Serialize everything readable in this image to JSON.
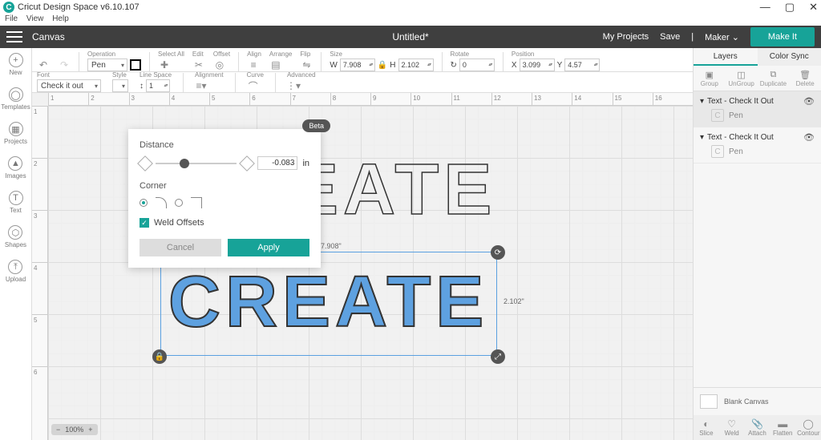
{
  "app": {
    "title": "Cricut Design Space v6.10.107"
  },
  "menu": {
    "file": "File",
    "view": "View",
    "help": "Help"
  },
  "top": {
    "canvas": "Canvas",
    "doc": "Untitled*",
    "projects": "My Projects",
    "save": "Save",
    "machine": "Maker",
    "makeit": "Make It"
  },
  "leftnav": [
    {
      "label": "New",
      "glyph": "+"
    },
    {
      "label": "Templates",
      "glyph": "◯"
    },
    {
      "label": "Projects",
      "glyph": "▦"
    },
    {
      "label": "Images",
      "glyph": "▲"
    },
    {
      "label": "Text",
      "glyph": "T"
    },
    {
      "label": "Shapes",
      "glyph": "⬡"
    },
    {
      "label": "Upload",
      "glyph": "⤒"
    }
  ],
  "ribbon": {
    "operation": {
      "label": "Operation",
      "value": "Pen"
    },
    "selectall": "Select All",
    "edit": "Edit",
    "offset": "Offset",
    "align": "Align",
    "arrange": "Arrange",
    "flip": "Flip",
    "size": {
      "label": "Size",
      "w": "7.908",
      "h": "2.102"
    },
    "rotate": {
      "label": "Rotate",
      "value": "0"
    },
    "position": {
      "label": "Position",
      "x": "3.099",
      "y": "4.57"
    }
  },
  "ribbon2": {
    "font": {
      "label": "Font",
      "value": "Check it out"
    },
    "style": "Style",
    "lineSpace": {
      "label": "Line Space",
      "value": "1"
    },
    "alignment": "Alignment",
    "curve": "Curve",
    "advanced": "Advanced"
  },
  "popup": {
    "beta": "Beta",
    "distance": "Distance",
    "distval": "-0.083",
    "distunit": "in",
    "corner": "Corner",
    "weld": "Weld Offsets",
    "cancel": "Cancel",
    "apply": "Apply"
  },
  "canvasObjs": {
    "text": "CREATE",
    "dimW": "7.908\"",
    "dimH": "2.102\""
  },
  "layers": {
    "tabLayers": "Layers",
    "tabColor": "Color Sync",
    "ops": {
      "group": "Group",
      "ungroup": "UnGroup",
      "duplicate": "Duplicate",
      "delete": "Delete"
    },
    "items": [
      {
        "name": "Text - Check It Out",
        "sub": "Pen"
      },
      {
        "name": "Text - Check It Out",
        "sub": "Pen"
      }
    ],
    "blank": "Blank Canvas",
    "bottom": {
      "slice": "Slice",
      "weld": "Weld",
      "attach": "Attach",
      "flatten": "Flatten",
      "contour": "Contour"
    }
  },
  "zoom": {
    "pct": "100%"
  }
}
